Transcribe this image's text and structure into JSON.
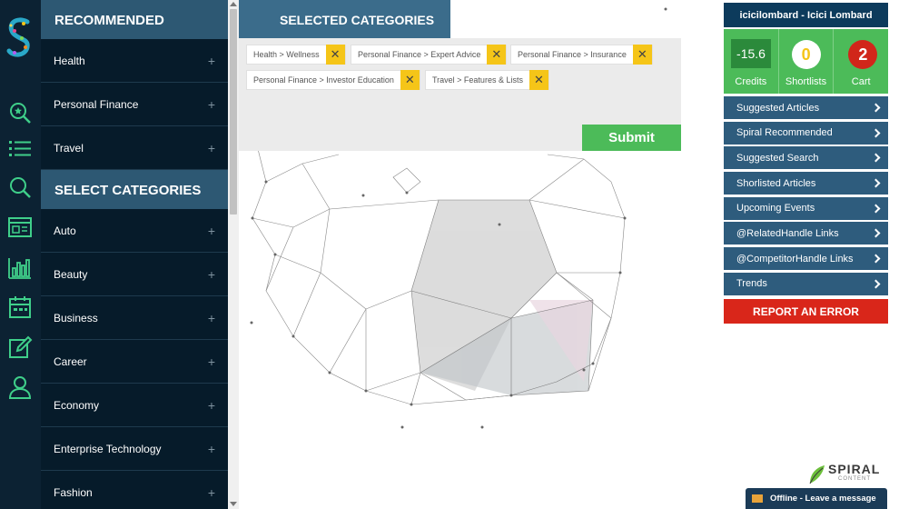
{
  "rail": {
    "icons": [
      "spiral-logo-icon",
      "search-star-icon",
      "list-icon",
      "search-icon",
      "browser-window-icon",
      "bar-chart-icon",
      "calendar-icon",
      "edit-icon",
      "user-icon"
    ]
  },
  "recommended": {
    "header": "RECOMMENDED",
    "items": [
      {
        "label": "Health"
      },
      {
        "label": "Personal Finance"
      },
      {
        "label": "Travel"
      }
    ]
  },
  "select_categories": {
    "header": "SELECT CATEGORIES",
    "items": [
      {
        "label": "Auto"
      },
      {
        "label": "Beauty"
      },
      {
        "label": "Business"
      },
      {
        "label": "Career"
      },
      {
        "label": "Economy"
      },
      {
        "label": "Enterprise Technology"
      },
      {
        "label": "Fashion"
      }
    ]
  },
  "plus_glyph": "+",
  "selected": {
    "header": "SELECTED CATEGORIES",
    "tags": [
      {
        "label": "Health > Wellness"
      },
      {
        "label": "Personal Finance > Expert Advice"
      },
      {
        "label": "Personal Finance > Insurance"
      },
      {
        "label": "Personal Finance > Investor Education"
      },
      {
        "label": "Travel > Features & Lists"
      }
    ],
    "remove_glyph": "✕",
    "submit_label": "Submit"
  },
  "account": {
    "name": "icicilombard - Icici Lombard",
    "credits_value": "-15.6",
    "credits_label": "Credits",
    "shortlists_value": "0",
    "shortlists_label": "Shortlists",
    "cart_value": "2",
    "cart_label": "Cart"
  },
  "menu": [
    {
      "label": "Suggested Articles"
    },
    {
      "label": "Spiral Recommended"
    },
    {
      "label": "Suggested Search"
    },
    {
      "label": "Shorlisted Articles"
    },
    {
      "label": "Upcoming Events"
    },
    {
      "label": "@RelatedHandle Links"
    },
    {
      "label": "@CompetitorHandle Links"
    },
    {
      "label": "Trends"
    }
  ],
  "report_label": "REPORT AN ERROR",
  "brand": {
    "name": "SPIRAL",
    "sub": "CONTENT"
  },
  "chat": {
    "label": "Offline - Leave a message"
  },
  "colors": {
    "rail": "#0c2233",
    "panel": "#061b2a",
    "panel_header": "#2d5873",
    "accent_green": "#4cbb59",
    "accent_yellow": "#f5c518",
    "menu_blue": "#2e5c7d",
    "report_red": "#d9261a"
  }
}
